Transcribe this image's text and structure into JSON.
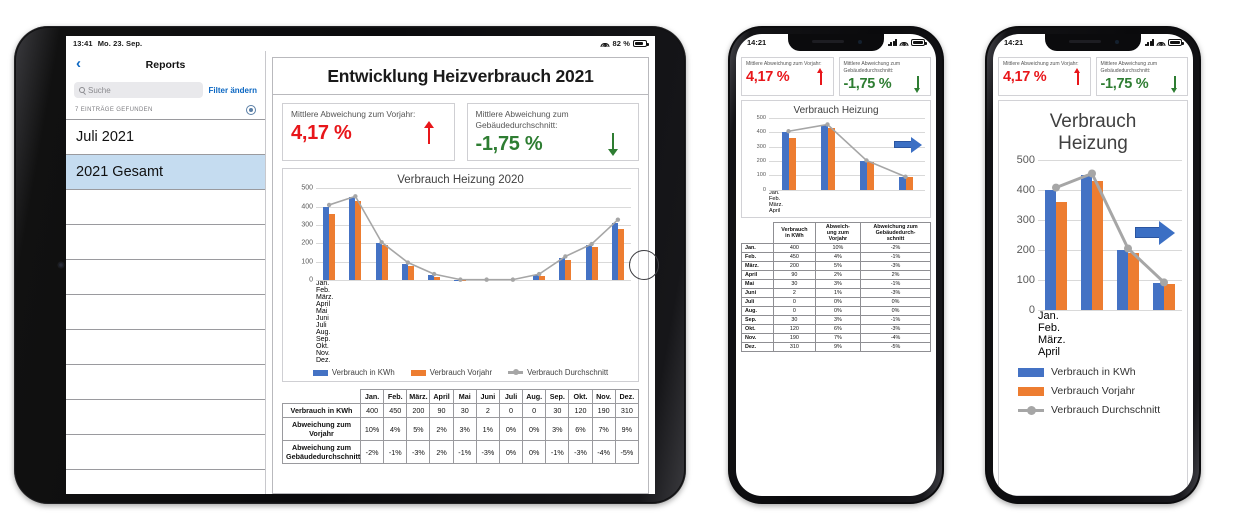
{
  "ipad": {
    "status": {
      "time": "13:41",
      "date": "Mo. 23. Sep.",
      "battery": "82 %"
    },
    "sidebar": {
      "back_icon": "chevron-left-icon",
      "title": "Reports",
      "search_placeholder": "Suche",
      "filter_label": "Filter ändern",
      "count_label": "7 EINTRÄGE GEFUNDEN",
      "items": [
        {
          "label": "Juli 2021",
          "selected": false
        },
        {
          "label": "2021 Gesamt",
          "selected": true
        }
      ],
      "blank_rows": 8
    },
    "report": {
      "title": "Entwicklung Heizverbrauch 2021",
      "kpis": [
        {
          "label": "Mittlere Abweichung zum Vorjahr:",
          "value": "4,17 %",
          "direction": "up",
          "color": "#e8161a"
        },
        {
          "label": "Mittlere Abweichung zum Gebäudedurchschnitt:",
          "value": "-1,75 %",
          "direction": "down",
          "color": "#2e7d32"
        }
      ]
    }
  },
  "phone1": {
    "status": {
      "time": "14:21"
    },
    "kpis": [
      {
        "label": "Mittlere Abweichung zum Vorjahr:",
        "value": "4,17 %",
        "direction": "up"
      },
      {
        "label": "Mittlere Abweichung zum Gebäudedurchschnitt:",
        "value": "-1,75 %",
        "direction": "down"
      }
    ],
    "chart_title": "Verbrauch Heizung"
  },
  "phone2": {
    "status": {
      "time": "14:21"
    },
    "kpis": [
      {
        "label": "Mittlere Abweichung zum Vorjahr:",
        "value": "4,17 %",
        "direction": "up"
      },
      {
        "label": "Mittlere Abweichung zum Gebäudedurchschnitt:",
        "value": "-1,75 %",
        "direction": "down"
      }
    ],
    "chart_title_line1": "Verbrauch",
    "chart_title_line2": "Heizung"
  },
  "legend": {
    "series1": "Verbrauch in KWh",
    "series2": "Verbrauch Vorjahr",
    "series3": "Verbrauch Durchschnitt"
  },
  "table": {
    "row_headers": [
      "Verbrauch in KWh",
      "Abweichung zum Vorjahr",
      "Abweichung zum Gebäudedurchschnitt"
    ],
    "col_headers": [
      "Jan.",
      "Feb.",
      "März.",
      "April",
      "Mai",
      "Juni",
      "Juli",
      "Aug.",
      "Sep.",
      "Okt.",
      "Nov.",
      "Dez."
    ],
    "verbrauch": [
      "400",
      "450",
      "200",
      "90",
      "30",
      "2",
      "0",
      "0",
      "30",
      "120",
      "190",
      "310"
    ],
    "abw_vorjahr": [
      "10%",
      "4%",
      "5%",
      "2%",
      "3%",
      "1%",
      "0%",
      "0%",
      "3%",
      "6%",
      "7%",
      "9%"
    ],
    "abw_vorjahr_sign": [
      "pos",
      "pos",
      "pos",
      "pos",
      "pos",
      "pos",
      "zero",
      "zero",
      "pos",
      "pos",
      "pos",
      "pos"
    ],
    "abw_gebaeude": [
      "-2%",
      "-1%",
      "-3%",
      "2%",
      "-1%",
      "-3%",
      "0%",
      "0%",
      "-1%",
      "-3%",
      "-4%",
      "-5%"
    ],
    "abw_gebaeude_sign": [
      "neg",
      "neg",
      "neg",
      "pos",
      "neg",
      "neg",
      "zero",
      "zero",
      "neg",
      "neg",
      "neg",
      "neg"
    ]
  },
  "phone_table": {
    "col_headers": [
      "Verbrauch in KWh",
      "Abweich- ung zum Vorjahr",
      "Abweichung zum Gebäudedurch- schnitt"
    ],
    "col_header_lines": [
      [
        "Verbrauch",
        "in KWh"
      ],
      [
        "Abweich-",
        "ung zum",
        "Vorjahr"
      ],
      [
        "Abweichung zum",
        "Gebäudedurch-",
        "schnitt"
      ]
    ],
    "rows": [
      {
        "month": "Jan.",
        "verbrauch": "400",
        "vorjahr": "10%",
        "vorjahr_sign": "pos",
        "gebaeude": "-2%",
        "gebaeude_sign": "neg"
      },
      {
        "month": "Feb.",
        "verbrauch": "450",
        "vorjahr": "4%",
        "vorjahr_sign": "pos",
        "gebaeude": "-1%",
        "gebaeude_sign": "neg"
      },
      {
        "month": "März.",
        "verbrauch": "200",
        "vorjahr": "5%",
        "vorjahr_sign": "pos",
        "gebaeude": "-3%",
        "gebaeude_sign": "neg"
      },
      {
        "month": "April",
        "verbrauch": "90",
        "vorjahr": "2%",
        "vorjahr_sign": "pos",
        "gebaeude": "2%",
        "gebaeude_sign": "pos"
      },
      {
        "month": "Mai",
        "verbrauch": "30",
        "vorjahr": "3%",
        "vorjahr_sign": "pos",
        "gebaeude": "-1%",
        "gebaeude_sign": "neg"
      },
      {
        "month": "Juni",
        "verbrauch": "2",
        "vorjahr": "1%",
        "vorjahr_sign": "pos",
        "gebaeude": "-3%",
        "gebaeude_sign": "neg"
      },
      {
        "month": "Juli",
        "verbrauch": "0",
        "vorjahr": "0%",
        "vorjahr_sign": "zero",
        "gebaeude": "0%",
        "gebaeude_sign": "zero"
      },
      {
        "month": "Aug.",
        "verbrauch": "0",
        "vorjahr": "0%",
        "vorjahr_sign": "zero",
        "gebaeude": "0%",
        "gebaeude_sign": "zero"
      },
      {
        "month": "Sep.",
        "verbrauch": "30",
        "vorjahr": "3%",
        "vorjahr_sign": "pos",
        "gebaeude": "-1%",
        "gebaeude_sign": "neg"
      },
      {
        "month": "Okt.",
        "verbrauch": "120",
        "vorjahr": "6%",
        "vorjahr_sign": "pos",
        "gebaeude": "-3%",
        "gebaeude_sign": "neg"
      },
      {
        "month": "Nov.",
        "verbrauch": "190",
        "vorjahr": "7%",
        "vorjahr_sign": "pos",
        "gebaeude": "-4%",
        "gebaeude_sign": "neg"
      },
      {
        "month": "Dez.",
        "verbrauch": "310",
        "vorjahr": "9%",
        "vorjahr_sign": "pos",
        "gebaeude": "-5%",
        "gebaeude_sign": "neg"
      }
    ]
  },
  "chart_data": [
    {
      "id": "ipad_chart",
      "type": "bar",
      "title": "Verbrauch Heizung 2020",
      "categories": [
        "Jan.",
        "Feb.",
        "März.",
        "April",
        "Mai",
        "Juni",
        "Juli",
        "Aug.",
        "Sep.",
        "Okt.",
        "Nov.",
        "Dez."
      ],
      "series": [
        {
          "name": "Verbrauch in KWh",
          "type": "bar",
          "color": "#4472c4",
          "values": [
            400,
            450,
            200,
            90,
            30,
            2,
            0,
            0,
            30,
            120,
            190,
            310
          ]
        },
        {
          "name": "Verbrauch Vorjahr",
          "type": "bar",
          "color": "#ed7d31",
          "values": [
            362,
            432,
            190,
            78,
            15,
            1,
            0,
            0,
            22,
            112,
            180,
            280
          ]
        },
        {
          "name": "Verbrauch Durchschnitt",
          "type": "line",
          "color": "#a6a6a6",
          "values": [
            408,
            455,
            205,
            95,
            32,
            2,
            2,
            2,
            32,
            128,
            195,
            328
          ]
        }
      ],
      "ylim": [
        0,
        500
      ],
      "yticks": [
        0,
        100,
        200,
        300,
        400,
        500
      ],
      "xlabel": "",
      "ylabel": "",
      "grid": true,
      "legend_position": "bottom"
    },
    {
      "id": "phone1_chart",
      "type": "bar",
      "title": "Verbrauch Heizung",
      "categories": [
        "Jan.",
        "Feb.",
        "März.",
        "April"
      ],
      "series": [
        {
          "name": "Verbrauch in KWh",
          "type": "bar",
          "color": "#4472c4",
          "values": [
            400,
            450,
            200,
            90
          ]
        },
        {
          "name": "Verbrauch Vorjahr",
          "type": "bar",
          "color": "#ed7d31",
          "values": [
            362,
            432,
            190,
            88
          ]
        },
        {
          "name": "Verbrauch Durchschnitt",
          "type": "line",
          "color": "#a6a6a6",
          "values": [
            408,
            455,
            205,
            92
          ]
        }
      ],
      "ylim": [
        0,
        500
      ],
      "yticks": [
        0,
        100,
        200,
        300,
        400,
        500
      ],
      "grid": true,
      "annotation": "scroll-right-arrow"
    },
    {
      "id": "phone2_chart",
      "type": "bar",
      "title": "Verbrauch Heizung",
      "categories": [
        "Jan.",
        "Feb.",
        "März.",
        "April"
      ],
      "series": [
        {
          "name": "Verbrauch in KWh",
          "type": "bar",
          "color": "#4472c4",
          "values": [
            400,
            450,
            200,
            90
          ]
        },
        {
          "name": "Verbrauch Vorjahr",
          "type": "bar",
          "color": "#ed7d31",
          "values": [
            362,
            432,
            190,
            88
          ]
        },
        {
          "name": "Verbrauch Durchschnitt",
          "type": "line",
          "color": "#a6a6a6",
          "values": [
            408,
            455,
            205,
            92
          ]
        }
      ],
      "ylim": [
        0,
        500
      ],
      "yticks": [
        0,
        100,
        200,
        300,
        400,
        500
      ],
      "grid": true,
      "annotation": "scroll-right-arrow",
      "legend_position": "bottom"
    }
  ]
}
